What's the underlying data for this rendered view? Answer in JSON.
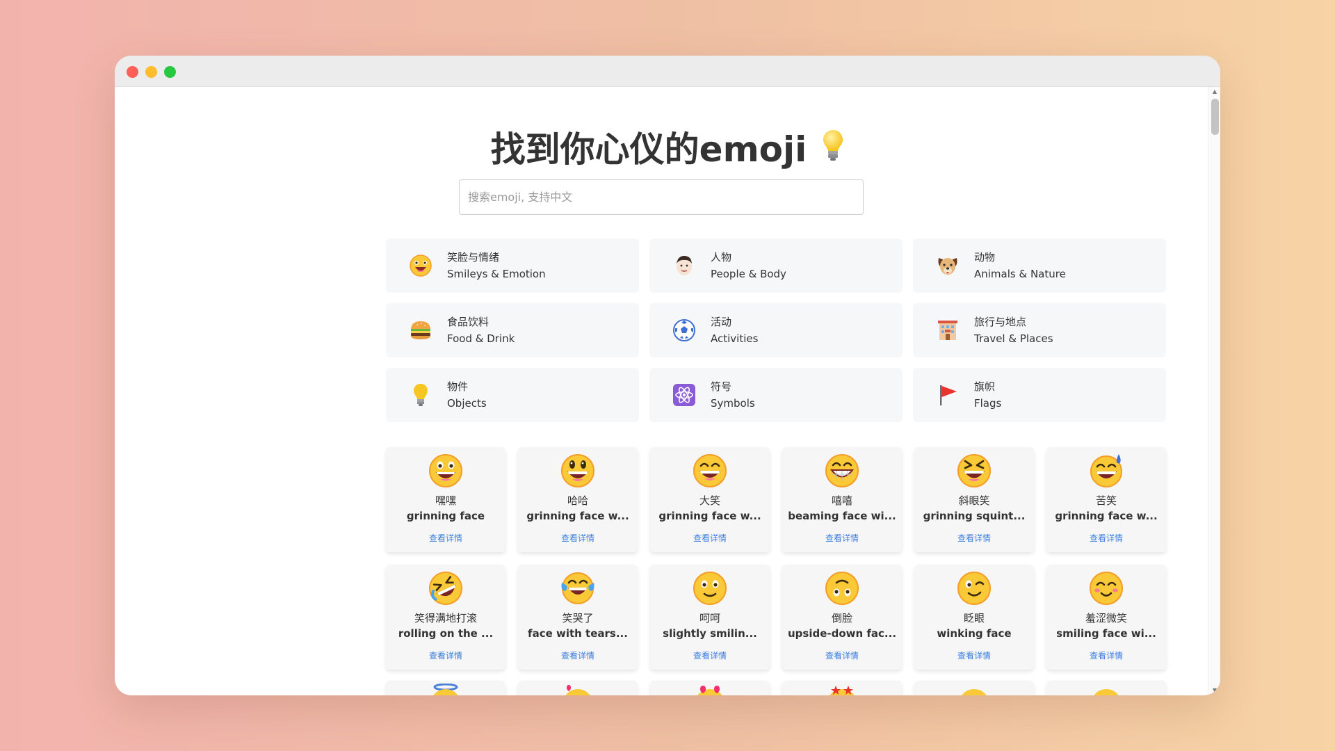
{
  "window": {
    "controls": [
      "close",
      "minimize",
      "maximize"
    ]
  },
  "header": {
    "title": "找到你心仪的emoji",
    "title_icon": "light-bulb-icon"
  },
  "search": {
    "placeholder": "搜索emoji, 支持中文",
    "value": ""
  },
  "categories": [
    {
      "cn": "笑脸与情绪",
      "en": "Smileys & Emotion",
      "icon": "smiley-icon"
    },
    {
      "cn": "人物",
      "en": "People & Body",
      "icon": "person-icon"
    },
    {
      "cn": "动物",
      "en": "Animals & Nature",
      "icon": "dog-icon"
    },
    {
      "cn": "食品饮料",
      "en": "Food & Drink",
      "icon": "burger-icon"
    },
    {
      "cn": "活动",
      "en": "Activities",
      "icon": "soccer-ball-icon"
    },
    {
      "cn": "旅行与地点",
      "en": "Travel & Places",
      "icon": "hotel-icon"
    },
    {
      "cn": "物件",
      "en": "Objects",
      "icon": "light-bulb-icon"
    },
    {
      "cn": "符号",
      "en": "Symbols",
      "icon": "atom-symbol-icon"
    },
    {
      "cn": "旗帜",
      "en": "Flags",
      "icon": "red-flag-icon"
    }
  ],
  "emojis": [
    {
      "cn": "嘿嘿",
      "en": "grinning face",
      "link": "查看详情",
      "icon": "grinning-face-icon"
    },
    {
      "cn": "哈哈",
      "en": "grinning face w...",
      "link": "查看详情",
      "icon": "grinning-face-big-eyes-icon"
    },
    {
      "cn": "大笑",
      "en": "grinning face w...",
      "link": "查看详情",
      "icon": "grinning-face-smiling-eyes-icon"
    },
    {
      "cn": "嘻嘻",
      "en": "beaming face wi...",
      "link": "查看详情",
      "icon": "beaming-face-icon"
    },
    {
      "cn": "斜眼笑",
      "en": "grinning squint...",
      "link": "查看详情",
      "icon": "grinning-squinting-face-icon"
    },
    {
      "cn": "苦笑",
      "en": "grinning face w...",
      "link": "查看详情",
      "icon": "grinning-face-sweat-icon"
    },
    {
      "cn": "笑得满地打滚",
      "en": "rolling on the ...",
      "link": "查看详情",
      "icon": "rolling-on-floor-laughing-icon"
    },
    {
      "cn": "笑哭了",
      "en": "face with tears...",
      "link": "查看详情",
      "icon": "face-with-tears-of-joy-icon"
    },
    {
      "cn": "呵呵",
      "en": "slightly smilin...",
      "link": "查看详情",
      "icon": "slightly-smiling-face-icon"
    },
    {
      "cn": "倒脸",
      "en": "upside-down fac...",
      "link": "查看详情",
      "icon": "upside-down-face-icon"
    },
    {
      "cn": "眨眼",
      "en": "winking face",
      "link": "查看详情",
      "icon": "winking-face-icon"
    },
    {
      "cn": "羞涩微笑",
      "en": "smiling face wi...",
      "link": "查看详情",
      "icon": "smiling-face-smiling-eyes-icon"
    }
  ],
  "colors": {
    "accent_link": "#3b7ddd",
    "emoji_yellow": "#f9c937",
    "emoji_orange": "#f59d27"
  }
}
